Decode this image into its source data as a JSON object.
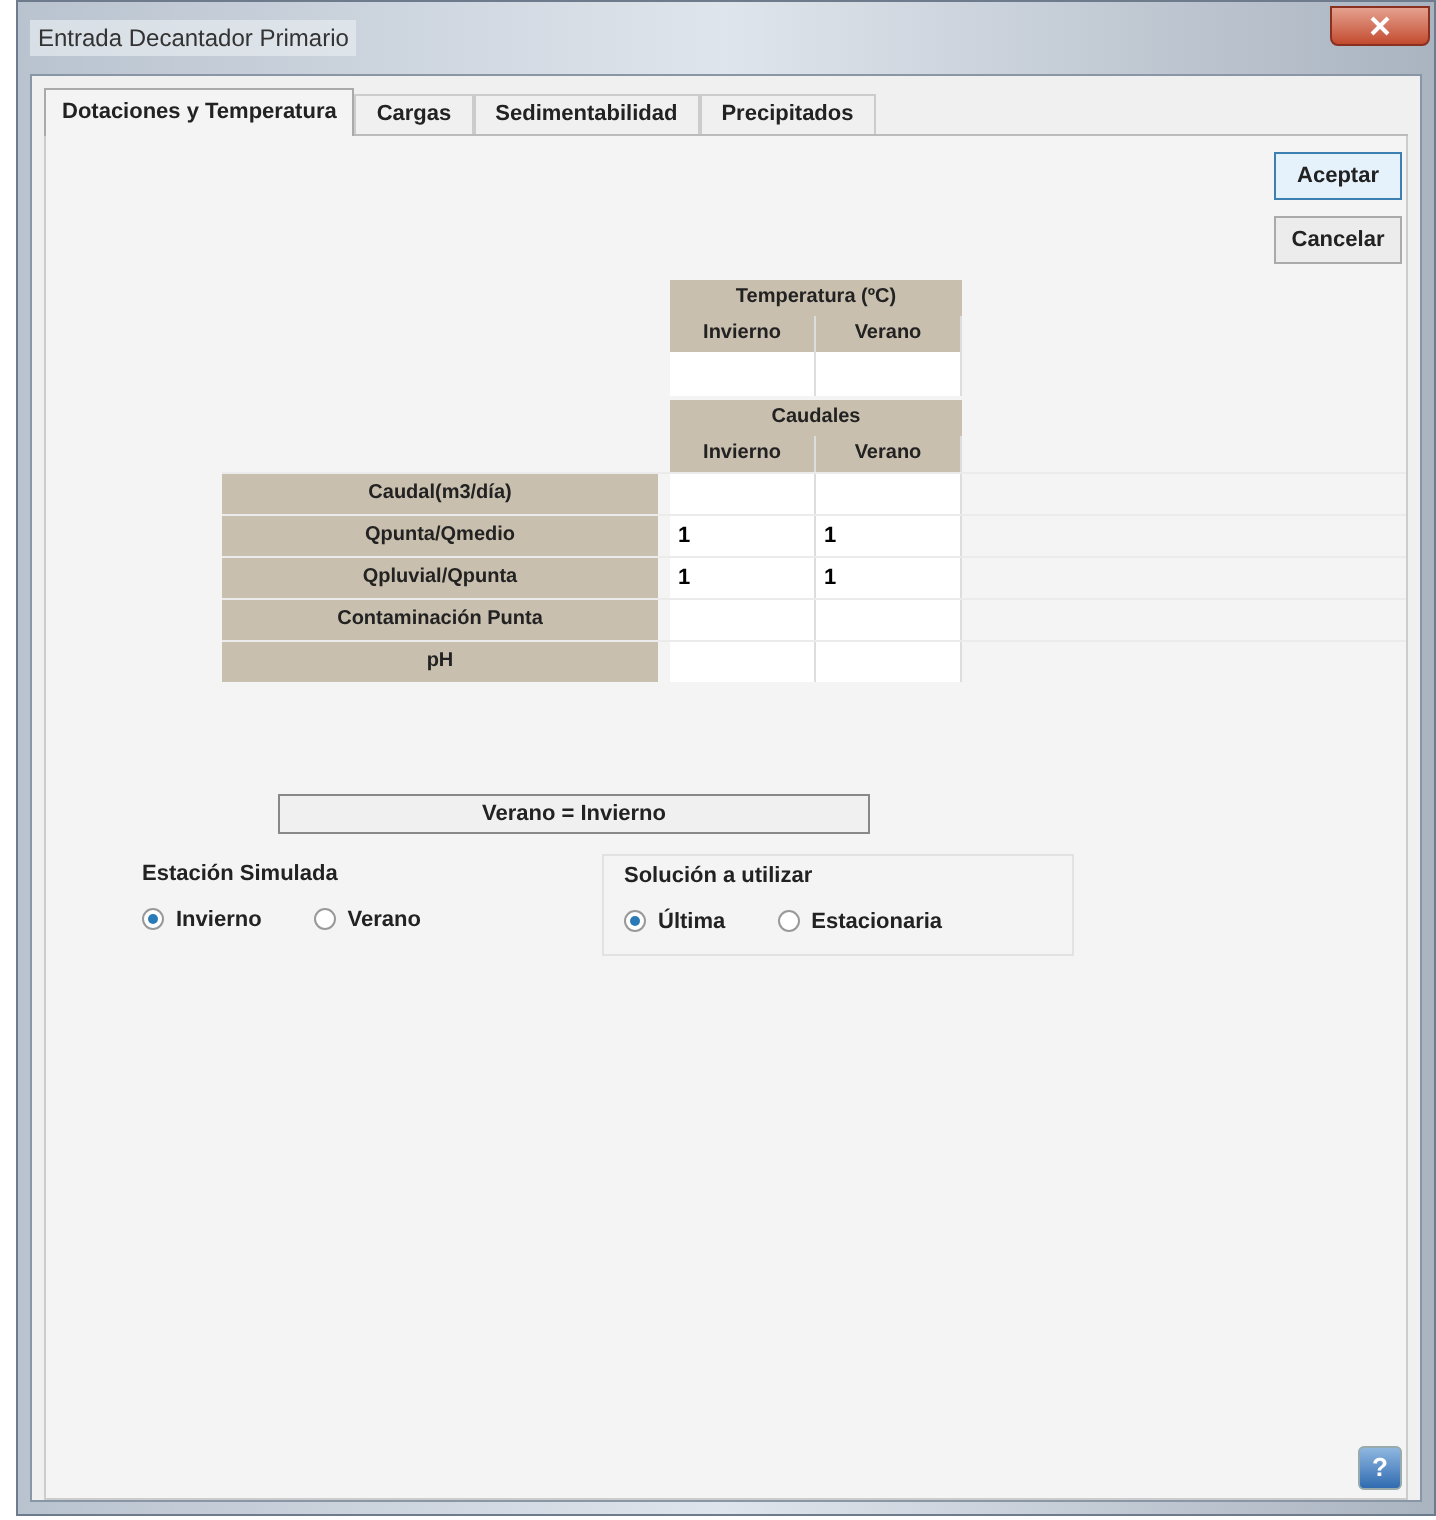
{
  "window": {
    "title": "Entrada Decantador Primario"
  },
  "tabs": [
    {
      "label": "Dotaciones y Temperatura",
      "selected": true
    },
    {
      "label": "Cargas",
      "selected": false
    },
    {
      "label": "Sedimentabilidad",
      "selected": false
    },
    {
      "label": "Precipitados",
      "selected": false
    }
  ],
  "buttons": [
    "Aceptar",
    "Cancelar"
  ],
  "temperature": {
    "title": "Temperatura (ºC)",
    "columns": [
      "Invierno",
      "Verano"
    ]
  },
  "caudales": {
    "title": "Caudales",
    "columns": [
      "Invierno",
      "Verano"
    ],
    "rows": [
      {
        "label": "Caudal(m3/día)"
      },
      {
        "label": "Qpunta/Qmedio",
        "values": [
          "1",
          "1"
        ]
      },
      {
        "label": "Qpluvial/Qpunta",
        "values": [
          "1",
          "1"
        ]
      },
      {
        "label": "Contaminación Punta"
      },
      {
        "label": "pH"
      }
    ]
  },
  "banner": "Verano = Invierno",
  "estacion": {
    "title": "Estación Simulada",
    "options": [
      {
        "label": "Invierno",
        "selected": true
      },
      {
        "label": "Verano",
        "selected": false
      }
    ]
  },
  "solucion": {
    "title": "Solución a utilizar",
    "options": [
      {
        "label": "Última",
        "selected": true
      },
      {
        "label": "Estacionaria",
        "selected": false
      }
    ]
  },
  "help": {
    "label": "?"
  }
}
